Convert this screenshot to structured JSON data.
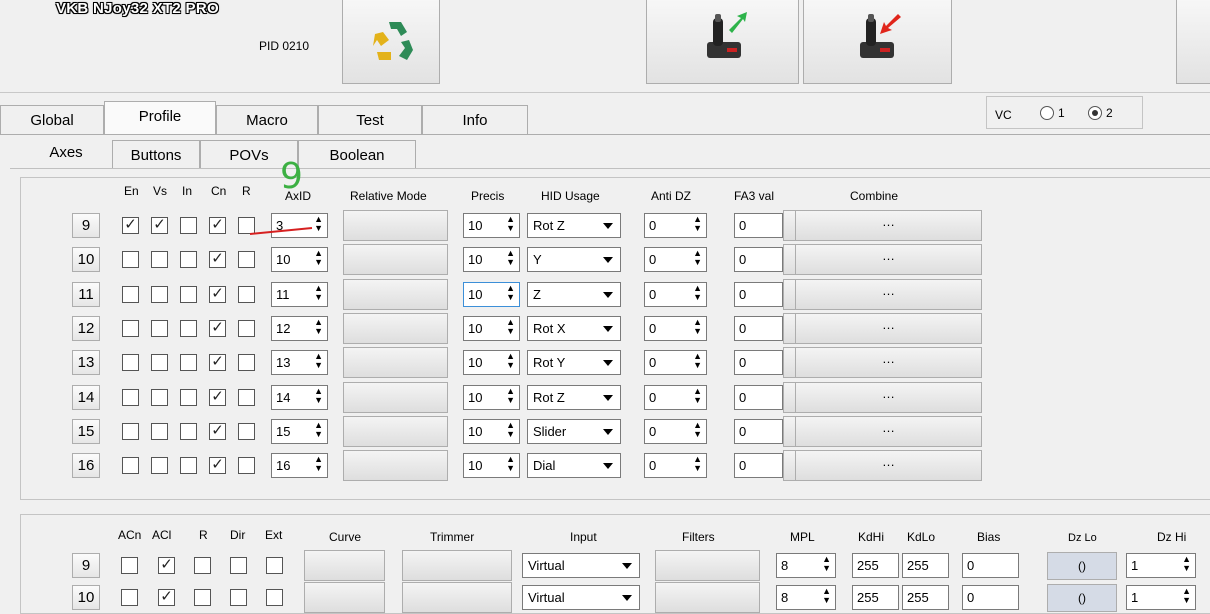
{
  "device": {
    "name": "VKB NJoy32 XT2 PRO",
    "pid": "PID 0210"
  },
  "icons": {
    "refresh": "recycle-arrows-icon",
    "upload": "joystick-upload-icon",
    "download": "joystick-download-icon"
  },
  "tabs": [
    "Global",
    "Profile",
    "Macro",
    "Test",
    "Info"
  ],
  "active_tab": "Profile",
  "vc": {
    "label": "VC",
    "options": [
      "1",
      "2"
    ],
    "selected": "2"
  },
  "subtabs": [
    "Axes",
    "Buttons",
    "POVs",
    "Boolean"
  ],
  "active_subtab": "Axes",
  "annotation": {
    "text": "9"
  },
  "axes": {
    "headers": {
      "en": "En",
      "vs": "Vs",
      "in": "In",
      "cn": "Cn",
      "r": "R",
      "axid": "AxID",
      "relative": "Relative Mode",
      "precis": "Precis",
      "hid": "HID Usage",
      "antidz": "Anti DZ",
      "fa3": "FA3 val",
      "combine": "Combine"
    },
    "rows": [
      {
        "n": "9",
        "en": true,
        "vs": true,
        "in": false,
        "cn": true,
        "r": false,
        "axid": "3",
        "precis": "10",
        "hid": "Rot Z",
        "antidz": "0",
        "fa3": "0",
        "combine": "…"
      },
      {
        "n": "10",
        "en": false,
        "vs": false,
        "in": false,
        "cn": true,
        "r": false,
        "axid": "10",
        "precis": "10",
        "hid": "Y",
        "antidz": "0",
        "fa3": "0",
        "combine": "…"
      },
      {
        "n": "11",
        "en": false,
        "vs": false,
        "in": false,
        "cn": true,
        "r": false,
        "axid": "11",
        "precis": "10",
        "hid": "Z",
        "antidz": "0",
        "fa3": "0",
        "combine": "…"
      },
      {
        "n": "12",
        "en": false,
        "vs": false,
        "in": false,
        "cn": true,
        "r": false,
        "axid": "12",
        "precis": "10",
        "hid": "Rot X",
        "antidz": "0",
        "fa3": "0",
        "combine": "…"
      },
      {
        "n": "13",
        "en": false,
        "vs": false,
        "in": false,
        "cn": true,
        "r": false,
        "axid": "13",
        "precis": "10",
        "hid": "Rot Y",
        "antidz": "0",
        "fa3": "0",
        "combine": "…"
      },
      {
        "n": "14",
        "en": false,
        "vs": false,
        "in": false,
        "cn": true,
        "r": false,
        "axid": "14",
        "precis": "10",
        "hid": "Rot Z",
        "antidz": "0",
        "fa3": "0",
        "combine": "…"
      },
      {
        "n": "15",
        "en": false,
        "vs": false,
        "in": false,
        "cn": true,
        "r": false,
        "axid": "15",
        "precis": "10",
        "hid": "Slider",
        "antidz": "0",
        "fa3": "0",
        "combine": "…"
      },
      {
        "n": "16",
        "en": false,
        "vs": false,
        "in": false,
        "cn": true,
        "r": false,
        "axid": "16",
        "precis": "10",
        "hid": "Dial",
        "antidz": "0",
        "fa3": "0",
        "combine": "…"
      }
    ]
  },
  "lower": {
    "headers": {
      "acn": "ACn",
      "acl": "ACl",
      "r": "R",
      "dir": "Dir",
      "ext": "Ext",
      "curve": "Curve",
      "trimmer": "Trimmer",
      "input": "Input",
      "filters": "Filters",
      "mpl": "MPL",
      "kdhi": "KdHi",
      "kdlo": "KdLo",
      "bias": "Bias",
      "dzlo": "Dz Lo",
      "dzhi": "Dz Hi"
    },
    "rows": [
      {
        "n": "9",
        "acn": false,
        "acl": true,
        "r": false,
        "dir": false,
        "ext": false,
        "input": "Virtual",
        "mpl": "8",
        "kdhi": "255",
        "kdlo": "255",
        "bias": "0",
        "dzlo": "()",
        "dzhi": "1"
      },
      {
        "n": "10",
        "acn": false,
        "acl": true,
        "r": false,
        "dir": false,
        "ext": false,
        "input": "Virtual",
        "mpl": "8",
        "kdhi": "255",
        "kdlo": "255",
        "bias": "0",
        "dzlo": "()",
        "dzhi": "1"
      }
    ]
  }
}
